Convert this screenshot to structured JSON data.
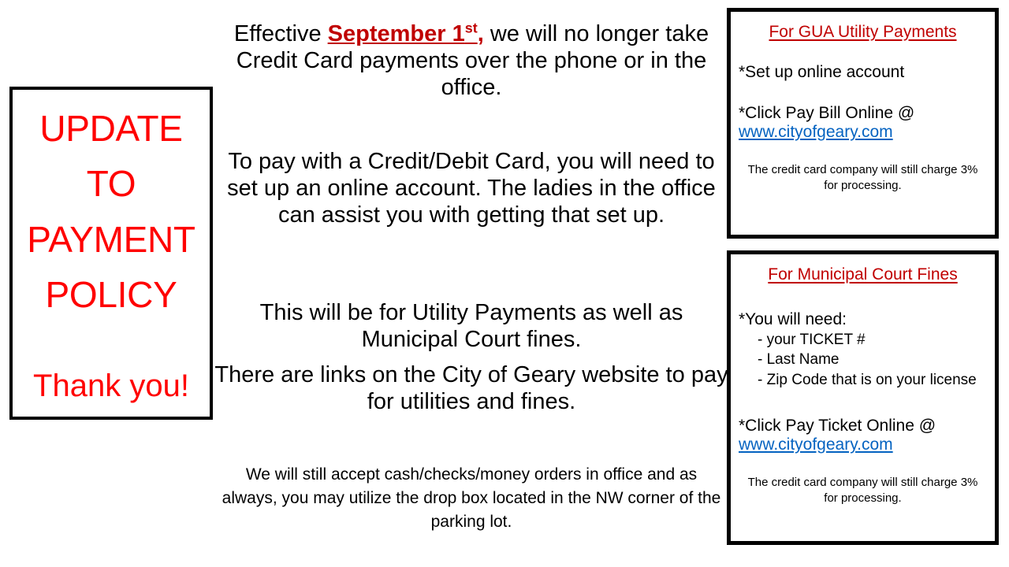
{
  "update_box": {
    "headline_lines": [
      "UPDATE",
      "TO",
      "PAYMENT",
      "POLICY"
    ],
    "thanks": "Thank you!",
    "text_color": "#FF0000",
    "border_color": "#000000"
  },
  "main": {
    "effective": {
      "prefix": "Effective ",
      "emphasis": "September 1",
      "emphasis_sup": "st",
      "emphasis_suffix": ",",
      "rest": " we will no longer take Credit Card payments over the phone or in the office.",
      "emphasis_color": "#C00000"
    },
    "setup_paragraph": "To pay with a Credit/Debit Card, you will need to set up an online account. The ladies in the office can assist you with getting that set up.",
    "utility_paragraph": "This will be for Utility Payments as well as Municipal Court fines.",
    "links_paragraph": "There are links on the City of Geary website to pay for utilities and fines.",
    "cash_paragraph": "We will still accept cash/checks/money orders in office and as always, you may utilize the drop box located in the NW corner of the parking lot."
  },
  "gua_box": {
    "title": "For GUA Utility Payments",
    "line1": "*Set up online account",
    "line2": "*Click Pay Bill Online @",
    "link": "www.cityofgeary.com",
    "fineprint": "The credit card company will still charge 3% for processing.",
    "title_color": "#C00000",
    "link_color": "#0563C1"
  },
  "court_box": {
    "title": "For Municipal Court Fines",
    "line1": "*You will need:",
    "bullets": [
      "-  your TICKET #",
      "- Last Name",
      "- Zip Code  that is on your license"
    ],
    "line2": "*Click Pay Ticket Online @",
    "link": "www.cityofgeary.com",
    "fineprint": "The credit card company will still charge 3% for processing.",
    "title_color": "#C00000",
    "link_color": "#0563C1"
  }
}
